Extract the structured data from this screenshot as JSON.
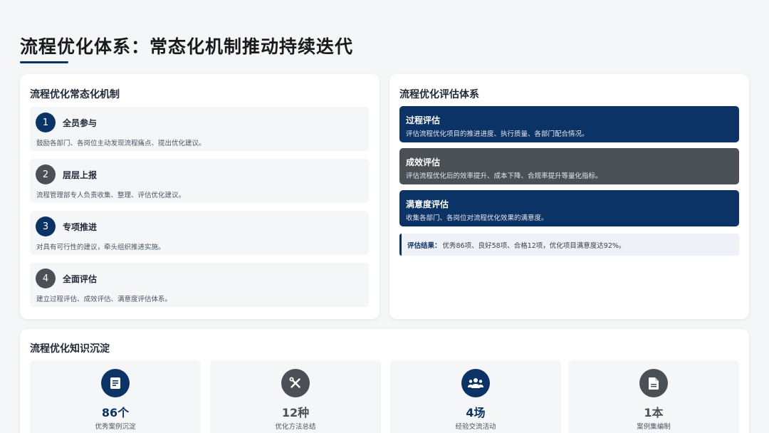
{
  "page": {
    "title": "流程优化体系：常态化机制推动持续迭代"
  },
  "mechanism": {
    "title": "流程优化常态化机制",
    "steps": [
      {
        "num": "1",
        "name": "全员参与",
        "desc": "鼓励各部门、各岗位主动发现流程痛点、提出优化建议。"
      },
      {
        "num": "2",
        "name": "层层上报",
        "desc": "流程管理部专人负责收集、整理、评估优化建议。"
      },
      {
        "num": "3",
        "name": "专项推进",
        "desc": "对具有可行性的建议，牵头组织推进实施。"
      },
      {
        "num": "4",
        "name": "全面评估",
        "desc": "建立过程评估、成效评估、满意度评估体系。"
      }
    ]
  },
  "evaluation": {
    "title": "流程优化评估体系",
    "items": [
      {
        "name": "过程评估",
        "desc": "评估流程优化项目的推进进度、执行质量、各部门配合情况。"
      },
      {
        "name": "成效评估",
        "desc": "评估流程优化后的效率提升、成本下降、合规率提升等量化指标。"
      },
      {
        "name": "满意度评估",
        "desc": "收集各部门、各岗位对流程优化效果的满意度。"
      }
    ],
    "result_label": "评估结果：",
    "result_text": "优秀86项、良好58项、合格12项，优化项目满意度达92%。"
  },
  "knowledge": {
    "title": "流程优化知识沉淀",
    "items": [
      {
        "value": "86个",
        "label": "优秀案例沉淀",
        "icon": "document-list-icon"
      },
      {
        "value": "12种",
        "label": "优化方法总结",
        "icon": "tools-icon"
      },
      {
        "value": "4场",
        "label": "经验交流活动",
        "icon": "people-icon"
      },
      {
        "value": "1本",
        "label": "案例集编制",
        "icon": "file-icon"
      }
    ]
  },
  "colors": {
    "navy": "#0b3366",
    "gray": "#4b5056",
    "background": "#f5f6f8"
  }
}
